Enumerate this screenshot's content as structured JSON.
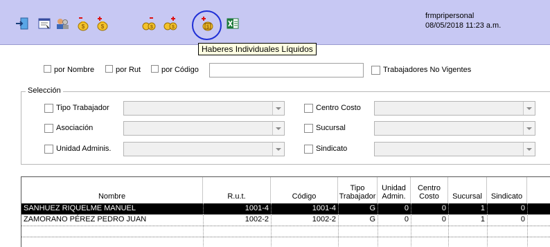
{
  "toolbar": {
    "buttons": [
      {
        "name": "exit-icon"
      },
      {
        "name": "report-view-icon"
      },
      {
        "name": "users-icon"
      },
      {
        "name": "money-bag-minus-icon"
      },
      {
        "name": "money-bag-plus-icon"
      },
      {
        "name": "money-bags-minus-icon"
      },
      {
        "name": "money-bags-plus-icon"
      },
      {
        "name": "money-bag-liquid-icon"
      },
      {
        "name": "excel-icon"
      }
    ],
    "tooltip": "Haberes Individuales Líquidos",
    "user": "frmpripersonal",
    "datetime": "08/05/2018 11:23 a.m."
  },
  "filter": {
    "por_nombre": "por Nombre",
    "por_rut": "por Rut",
    "por_codigo": "por Código",
    "search_value": "",
    "no_vigentes": "Trabajadores No Vigentes"
  },
  "seleccion": {
    "title": "Selección",
    "tipo_trabajador": "Tipo Trabajador",
    "asociacion": "Asociación",
    "unidad_adminis": "Unidad Adminis.",
    "centro_costo": "Centro Costo",
    "sucursal": "Sucursal",
    "sindicato": "Sindicato"
  },
  "grid": {
    "headers": {
      "nombre": "Nombre",
      "rut": "R.u.t.",
      "codigo": "Código",
      "tipo": "Tipo Trabajador",
      "unidad": "Unidad Admin.",
      "centro": "Centro Costo",
      "sucursal": "Sucursal",
      "sindicato": "Sindicato"
    },
    "rows": [
      {
        "nombre": "SANHUEZ RIQUELME MANUEL",
        "rut": "1001-4",
        "codigo": "1001-4",
        "tipo": "G",
        "unidad": "0",
        "centro": "0",
        "sucursal": "1",
        "sindicato": "0"
      },
      {
        "nombre": "ZAMORANO PÉREZ PEDRO JUAN",
        "rut": "1002-2",
        "codigo": "1002-2",
        "tipo": "G",
        "unidad": "0",
        "centro": "0",
        "sucursal": "1",
        "sindicato": "0"
      }
    ]
  }
}
